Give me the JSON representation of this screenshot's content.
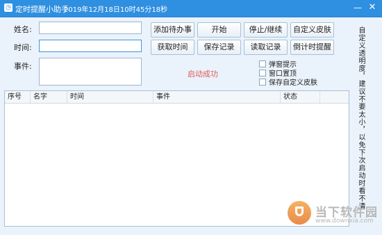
{
  "titlebar": {
    "title": "定时提醒小助手",
    "datetime": "2019年12月18日10时45分18秒",
    "minimize_glyph": "—",
    "close_glyph": "✕",
    "app_icon": "clock-icon"
  },
  "form": {
    "name_label": "姓名:",
    "name_value": "",
    "time_label": "时间:",
    "time_value": "",
    "event_label": "事件:",
    "event_value": ""
  },
  "buttons": {
    "add_todo": "添加待办事项",
    "start": "开始",
    "stop_continue": "停止/继续",
    "custom_skin": "自定义皮肤",
    "get_time": "获取时间",
    "save_record": "保存记录",
    "read_record": "读取记录",
    "countdown": "倒计时提醒"
  },
  "status": {
    "message": "启动成功"
  },
  "options": [
    {
      "label": "弹窗提示",
      "checked": false
    },
    {
      "label": "窗口置顶",
      "checked": false
    },
    {
      "label": "保存自定义皮肤",
      "checked": false
    }
  ],
  "table": {
    "columns": [
      "序号",
      "名字",
      "时间",
      "事件",
      "状态"
    ],
    "rows": []
  },
  "side_note": "自定义透明度，建议不要太小，以免下次启动时看不清",
  "watermark": {
    "name": "当下软件园",
    "url": "www.downxia.com"
  }
}
